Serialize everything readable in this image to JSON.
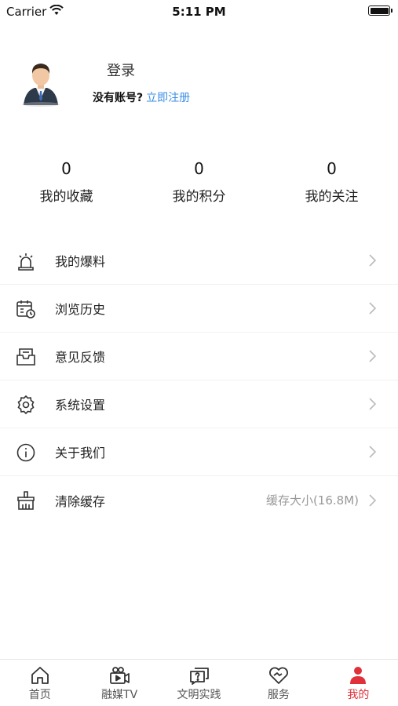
{
  "status_bar": {
    "carrier": "Carrier",
    "time": "5:11 PM"
  },
  "profile": {
    "login_label": "登录",
    "no_account_text": "没有账号?",
    "register_link": "立即注册"
  },
  "stats": [
    {
      "value": "0",
      "label": "我的收藏"
    },
    {
      "value": "0",
      "label": "我的积分"
    },
    {
      "value": "0",
      "label": "我的关注"
    }
  ],
  "menu": [
    {
      "label": "我的爆料",
      "icon": "alarm-icon"
    },
    {
      "label": "浏览历史",
      "icon": "calendar-clock-icon"
    },
    {
      "label": "意见反馈",
      "icon": "inbox-icon"
    },
    {
      "label": "系统设置",
      "icon": "gear-icon"
    },
    {
      "label": "关于我们",
      "icon": "info-icon"
    },
    {
      "label": "清除缓存",
      "icon": "broom-icon",
      "extra": "缓存大小(16.8M)"
    }
  ],
  "tabbar": {
    "accent_color": "#e0303a",
    "tabs": [
      {
        "label": "首页",
        "icon": "home-icon"
      },
      {
        "label": "融媒TV",
        "icon": "video-camera-icon"
      },
      {
        "label": "文明实践",
        "icon": "help-chat-icon"
      },
      {
        "label": "服务",
        "icon": "heart-hands-icon"
      },
      {
        "label": "我的",
        "icon": "person-icon",
        "active": true
      }
    ]
  }
}
